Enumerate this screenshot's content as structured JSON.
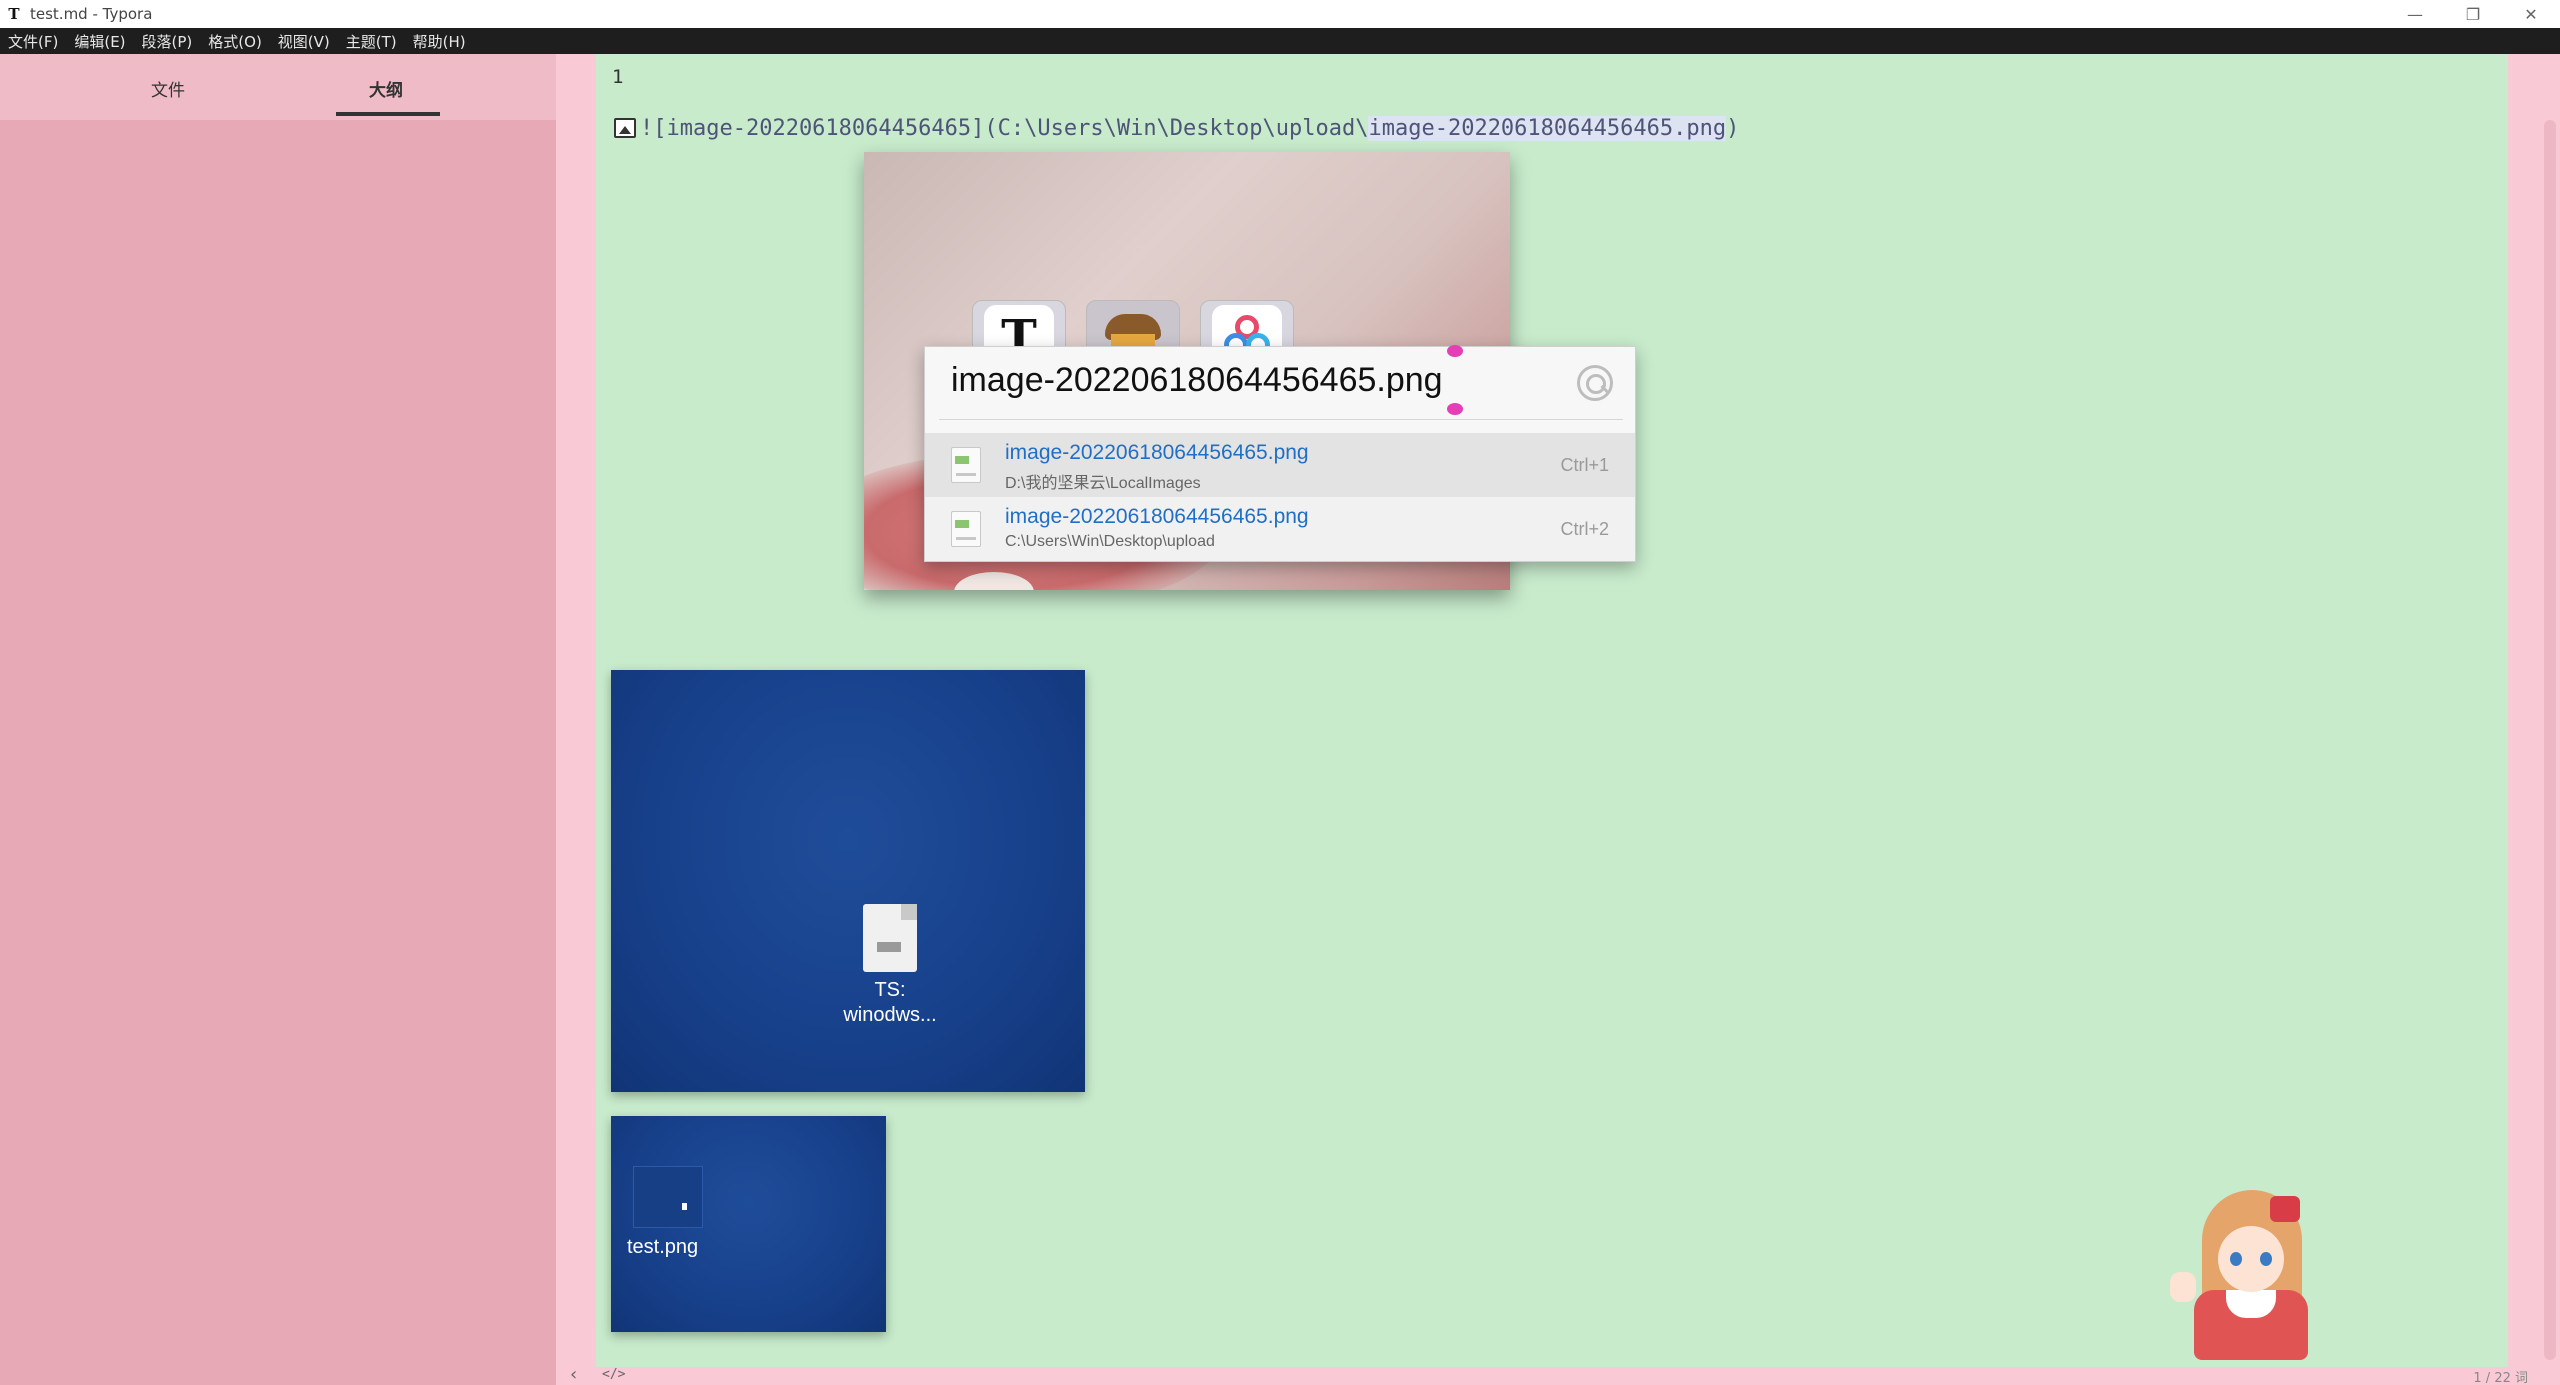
{
  "window": {
    "title": "test.md - Typora",
    "app_icon": "T",
    "controls": {
      "minimize": "—",
      "maximize": "❐",
      "close": "✕"
    }
  },
  "menu": [
    "文件(F)",
    "编辑(E)",
    "段落(P)",
    "格式(O)",
    "视图(V)",
    "主题(T)",
    "帮助(H)"
  ],
  "sidebar": {
    "tabs": [
      {
        "label": "文件",
        "active": false
      },
      {
        "label": "大纲",
        "active": true
      }
    ]
  },
  "editor": {
    "line_text": "1",
    "markdown_source": "![image-20220618064456465](C:\\Users\\Win\\Desktop\\upload\\image-20220618064456465.png)",
    "markdown_source_plain": "![image-20220618064456465](C:\\Users\\Win\\Desktop\\upload\\",
    "markdown_source_highlight": "image-20220618064456465.png",
    "markdown_source_end": ")"
  },
  "preview_dock_icons": [
    "typora-icon",
    "acorn-icon",
    "cloud-icon"
  ],
  "dock_glyph_t": "T",
  "search_popup": {
    "query": "image-20220618064456465.png",
    "results": [
      {
        "name": "image-20220618064456465.png",
        "path": "D:\\我的坚果云\\LocalImages",
        "shortcut": "Ctrl+1",
        "selected": true
      },
      {
        "name": "image-20220618064456465.png",
        "path": "C:\\Users\\Win\\Desktop\\upload",
        "shortcut": "Ctrl+2",
        "selected": false
      }
    ]
  },
  "desktop_thumbs": {
    "big_label_line1": "TS:",
    "big_label_line2": "winodws...",
    "small_label": "test.png"
  },
  "statusbar": {
    "back": "‹",
    "source_toggle": "</>",
    "word_count": "1 / 22 词"
  },
  "colors": {
    "sidebar_bg": "#e8a9b7",
    "editor_bg": "#c8ebcc",
    "frame_bg": "#f9c9d5",
    "link_blue": "#1f6fc6",
    "caret_pink": "#e43fb6"
  }
}
